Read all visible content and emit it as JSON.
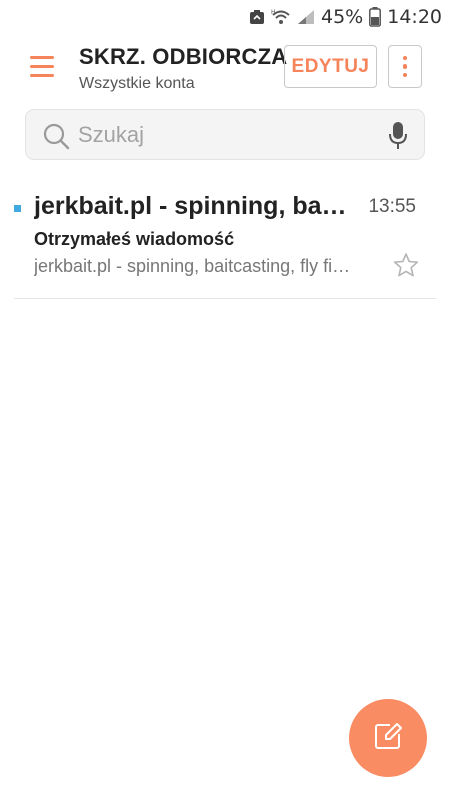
{
  "status_bar": {
    "battery_percent": "45%",
    "time": "14:20",
    "icons": [
      "recycle-icon",
      "wifi-icon",
      "signal-icon",
      "battery-icon"
    ]
  },
  "header": {
    "title": "SKRZ. ODBIORCZA",
    "subtitle": "Wszystkie konta",
    "edit_label": "EDYTUJ",
    "accent_color": "#f5845a"
  },
  "search": {
    "placeholder": "Szukaj",
    "value": ""
  },
  "mail_list": [
    {
      "sender": "jerkbait.pl - spinning, baitcasting, fly fishing",
      "time": "13:55",
      "subject": "Otrzymałeś wiadomość",
      "preview": "jerkbait.pl - spinning, baitcasting, fly fishing",
      "unread": true,
      "starred": false
    }
  ],
  "fab": {
    "icon": "compose-icon",
    "color": "#f98c63"
  }
}
